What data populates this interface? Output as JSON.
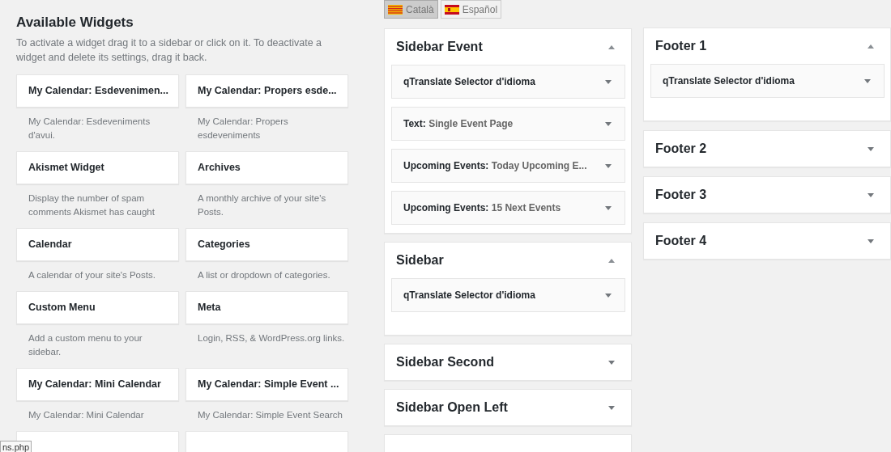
{
  "available": {
    "title": "Available Widgets",
    "description": "To activate a widget drag it to a sidebar or click on it. To deactivate a widget and delete its settings, drag it back.",
    "widgets": [
      {
        "kind": "full",
        "title": "My Calendar: Esdevenimen...",
        "description": "My Calendar: Esdeveniments d'avui."
      },
      {
        "kind": "full",
        "title": "My Calendar: Propers esde...",
        "description": "My Calendar: Propers esdeveniments"
      },
      {
        "kind": "full",
        "title": "Akismet Widget",
        "description": "Display the number of spam comments Akismet has caught"
      },
      {
        "kind": "full",
        "title": "Archives",
        "description": "A monthly archive of your site's Posts."
      },
      {
        "kind": "full",
        "title": "Calendar",
        "description": "A calendar of your site's Posts."
      },
      {
        "kind": "full",
        "title": "Categories",
        "description": "A list or dropdown of categories."
      },
      {
        "kind": "full",
        "title": "Custom Menu",
        "description": "Add a custom menu to your sidebar."
      },
      {
        "kind": "full",
        "title": "Meta",
        "description": "Login, RSS, & WordPress.org links."
      },
      {
        "kind": "full",
        "title": "My Calendar: Mini Calendar",
        "description": "My Calendar: Mini Calendar"
      },
      {
        "kind": "full",
        "title": "My Calendar: Simple Event ...",
        "description": "My Calendar: Simple Event Search"
      },
      {
        "kind": "cut"
      },
      {
        "kind": "cut"
      }
    ]
  },
  "languages": [
    {
      "label": "Català",
      "kind": "catalan",
      "selected": true
    },
    {
      "label": "Español",
      "kind": "spanish",
      "selected": false
    }
  ],
  "columns": [
    {
      "areas": [
        {
          "kind": "area",
          "title": "Sidebar Event",
          "expanded": true,
          "widgets": [
            {
              "name": "qTranslate Selector d'idioma"
            },
            {
              "name": "Text:",
              "title": "Single Event Page"
            },
            {
              "name": "Upcoming Events:",
              "title": "Today Upcoming E..."
            },
            {
              "name": "Upcoming Events:",
              "title": "15 Next Events"
            }
          ]
        },
        {
          "kind": "area",
          "title": "Sidebar",
          "expanded": true,
          "widgets": [
            {
              "name": "qTranslate Selector d'idioma"
            }
          ]
        },
        {
          "kind": "area",
          "title": "Sidebar Second",
          "expanded": false
        },
        {
          "kind": "area",
          "title": "Sidebar Open Left",
          "expanded": false
        },
        {
          "kind": "cut"
        }
      ]
    },
    {
      "areas": [
        {
          "kind": "area",
          "title": "Footer 1",
          "expanded": true,
          "widgets": [
            {
              "name": "qTranslate Selector d'idioma"
            }
          ]
        },
        {
          "kind": "area",
          "title": "Footer 2",
          "expanded": false
        },
        {
          "kind": "area",
          "title": "Footer 3",
          "expanded": false
        },
        {
          "kind": "area",
          "title": "Footer 4",
          "expanded": false
        }
      ]
    }
  ],
  "status_tooltip": "ns.php"
}
